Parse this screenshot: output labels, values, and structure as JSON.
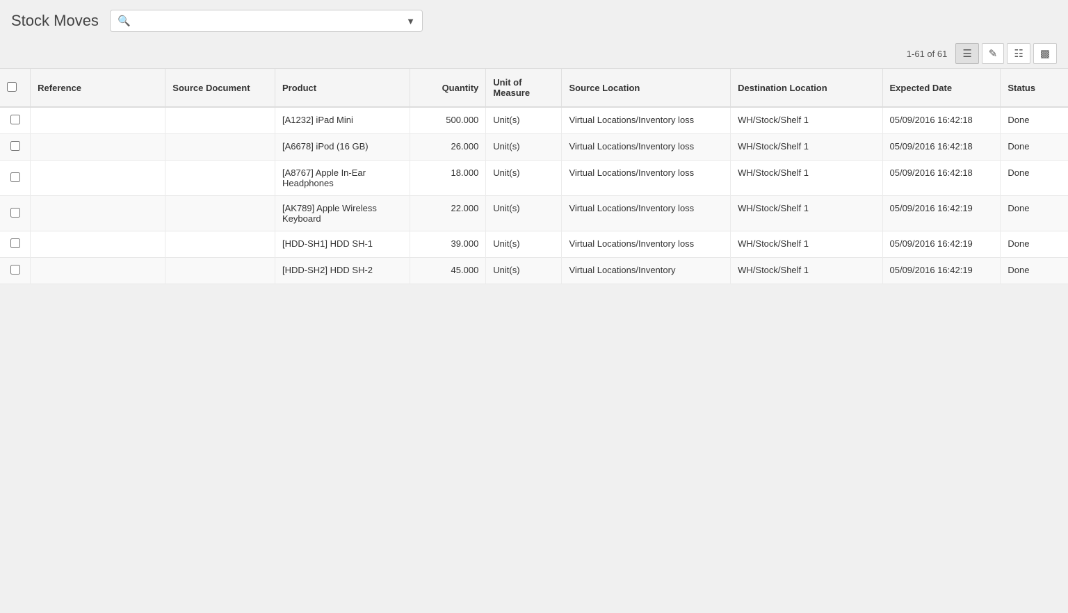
{
  "header": {
    "title": "Stock Moves",
    "search_placeholder": ""
  },
  "toolbar": {
    "record_count": "1-61 of 61"
  },
  "table": {
    "columns": [
      {
        "key": "checkbox",
        "label": ""
      },
      {
        "key": "reference",
        "label": "Reference"
      },
      {
        "key": "source_document",
        "label": "Source Document"
      },
      {
        "key": "product",
        "label": "Product"
      },
      {
        "key": "quantity",
        "label": "Quantity"
      },
      {
        "key": "uom",
        "label": "Unit of Measure"
      },
      {
        "key": "source_location",
        "label": "Source Location"
      },
      {
        "key": "destination_location",
        "label": "Destination Location"
      },
      {
        "key": "expected_date",
        "label": "Expected Date"
      },
      {
        "key": "status",
        "label": "Status"
      }
    ],
    "rows": [
      {
        "reference": "",
        "source_document": "",
        "product": "[A1232] iPad Mini",
        "quantity": "500.000",
        "uom": "Unit(s)",
        "source_location": "Virtual Locations/Inventory loss",
        "destination_location": "WH/Stock/Shelf 1",
        "expected_date": "05/09/2016 16:42:18",
        "status": "Done"
      },
      {
        "reference": "",
        "source_document": "",
        "product": "[A6678] iPod (16 GB)",
        "quantity": "26.000",
        "uom": "Unit(s)",
        "source_location": "Virtual Locations/Inventory loss",
        "destination_location": "WH/Stock/Shelf 1",
        "expected_date": "05/09/2016 16:42:18",
        "status": "Done"
      },
      {
        "reference": "",
        "source_document": "",
        "product": "[A8767] Apple In-Ear Headphones",
        "quantity": "18.000",
        "uom": "Unit(s)",
        "source_location": "Virtual Locations/Inventory loss",
        "destination_location": "WH/Stock/Shelf 1",
        "expected_date": "05/09/2016 16:42:18",
        "status": "Done"
      },
      {
        "reference": "",
        "source_document": "",
        "product": "[AK789] Apple Wireless Keyboard",
        "quantity": "22.000",
        "uom": "Unit(s)",
        "source_location": "Virtual Locations/Inventory loss",
        "destination_location": "WH/Stock/Shelf 1",
        "expected_date": "05/09/2016 16:42:19",
        "status": "Done"
      },
      {
        "reference": "",
        "source_document": "",
        "product": "[HDD-SH1] HDD SH-1",
        "quantity": "39.000",
        "uom": "Unit(s)",
        "source_location": "Virtual Locations/Inventory loss",
        "destination_location": "WH/Stock/Shelf 1",
        "expected_date": "05/09/2016 16:42:19",
        "status": "Done"
      },
      {
        "reference": "",
        "source_document": "",
        "product": "[HDD-SH2] HDD SH-2",
        "quantity": "45.000",
        "uom": "Unit(s)",
        "source_location": "Virtual Locations/Inventory",
        "destination_location": "WH/Stock/Shelf 1",
        "expected_date": "05/09/2016 16:42:19",
        "status": "Done"
      }
    ]
  }
}
